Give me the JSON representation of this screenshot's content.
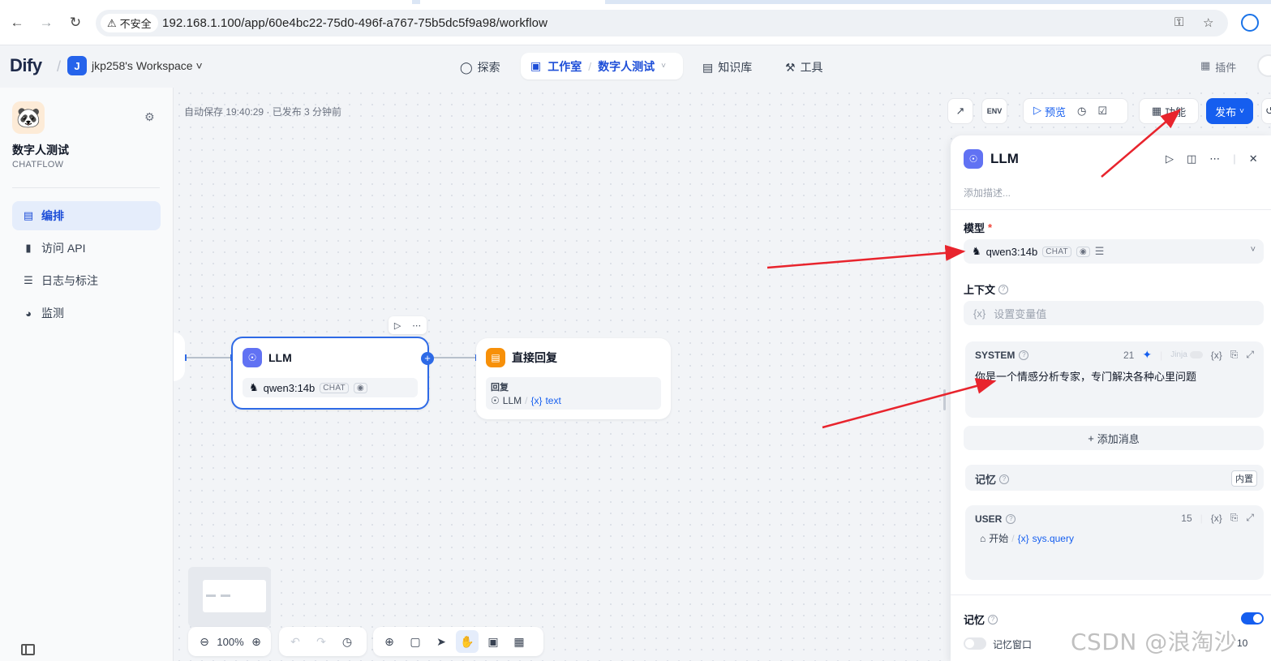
{
  "browser": {
    "insecure_label": "不安全",
    "url": "192.168.1.100/app/60e4bc22-75d0-496f-a767-75b5dc5f9a98/workflow"
  },
  "header": {
    "logo": "Dify",
    "workspace_initial": "J",
    "workspace_name": "jkp258's Workspace",
    "nav": {
      "explore": "探索",
      "studio": "工作室",
      "current_app": "数字人测试",
      "knowledge": "知识库",
      "tools": "工具",
      "plugins": "插件"
    }
  },
  "sidebar": {
    "app_name": "数字人测试",
    "app_mode": "CHATFLOW",
    "items": [
      {
        "label": "编排",
        "icon": "layout-icon",
        "active": true
      },
      {
        "label": "访问 API",
        "icon": "terminal-icon",
        "active": false
      },
      {
        "label": "日志与标注",
        "icon": "file-list-icon",
        "active": false
      },
      {
        "label": "监测",
        "icon": "dashboard-icon",
        "active": false
      }
    ]
  },
  "canvas": {
    "autosave": "自动保存 19:40:29 · 已发布 3 分钟前",
    "toolbar": {
      "env_label": "ENV",
      "preview": "预览",
      "features": "功能",
      "publish": "发布"
    },
    "llm_node": {
      "title": "LLM",
      "model": "qwen3:14b",
      "mode_tag": "CHAT"
    },
    "answer_node": {
      "title": "直接回复",
      "reply_label": "回复",
      "var_node": "LLM",
      "var_name": "text",
      "var_prefix": "{x}"
    },
    "zoom": "100%"
  },
  "panel": {
    "title": "LLM",
    "description_placeholder": "添加描述...",
    "model_label": "模型",
    "model_name": "qwen3:14b",
    "model_tag": "CHAT",
    "context_label": "上下文",
    "context_placeholder": "设置变量值",
    "system": {
      "role": "SYSTEM",
      "token_count": "21",
      "jinja": "Jinja",
      "text": "你是一个情感分析专家，专门解决各种心里问题"
    },
    "add_message": "添加消息",
    "memory_builtin_label": "记忆",
    "memory_builtin_badge": "内置",
    "user": {
      "role": "USER",
      "token_count": "15",
      "var_node": "开始",
      "var_name": "sys.query",
      "var_prefix": "{x}"
    },
    "memory_label": "记忆",
    "memory_window_label": "记忆窗口",
    "memory_window_value": "10"
  },
  "watermark": "CSDN @浪淘沙jkp",
  "colors": {
    "primary": "#155eef",
    "llm_icon": "#6172f3",
    "answer_icon": "#f79009",
    "annotation_arrow": "#e8242d"
  }
}
